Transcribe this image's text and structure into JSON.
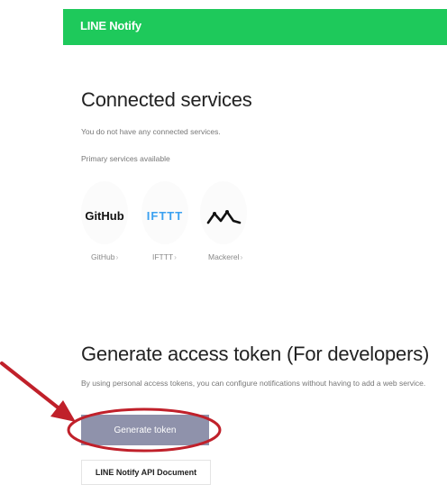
{
  "header": {
    "title": "LINE Notify"
  },
  "connected": {
    "title": "Connected services",
    "empty_text": "You do not have any connected services.",
    "primary_label": "Primary services available",
    "services": [
      {
        "logo_text": "GitHub",
        "label": "GitHub",
        "icon": "github-logo"
      },
      {
        "logo_text": "IFTTT",
        "label": "IFTTT",
        "icon": "ifttt-logo"
      },
      {
        "logo_text": "",
        "label": "Mackerel",
        "icon": "mackerel-logo"
      }
    ]
  },
  "generate": {
    "title": "Generate access token (For developers)",
    "description": "By using personal access tokens, you can configure notifications without having to add a web service.",
    "button_label": "Generate token",
    "doc_link_label": "LINE Notify API Document"
  },
  "colors": {
    "brand_green": "#1ec95b",
    "button": "#8f92ab",
    "ifttt_blue": "#3aa0f0",
    "annotation_red": "#c0202a"
  }
}
